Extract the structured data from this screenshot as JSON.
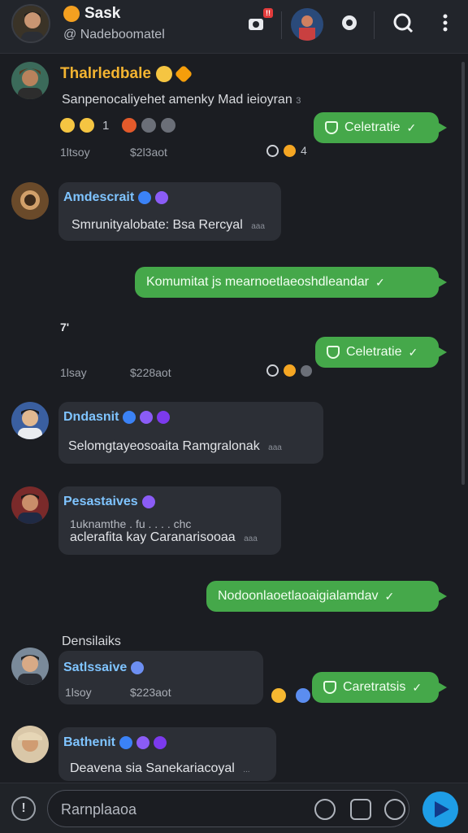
{
  "header": {
    "title": "Sask",
    "subtitle": "@ Nadeboomatel",
    "badge": "!!"
  },
  "messages": [
    {
      "name": "Thalrledbale",
      "text": "Sanpenocaliyehet amenky Mad ieioyran",
      "text_tail": "3",
      "react_count": "1",
      "meta_left": "1ltsoy",
      "meta_mid": "$2l3aot",
      "meta_right_num": "4"
    },
    {
      "name": "Amdescrait",
      "text": "Smrunityalobate: Bsa Rercyal",
      "ts": "aaa"
    },
    {
      "name": "Dndasnit",
      "text": "Selomgtayeosoaita Ramgralonak",
      "ts": "aaa"
    },
    {
      "name": "Pesastaives",
      "text_above": "1uknamthe . fu . . . . chc",
      "text": "aclerafita kay Caranarisooaa",
      "ts": "aaa"
    },
    {
      "name": "Satlssaive",
      "meta_left": "1lsoy",
      "meta_mid": "$223aot"
    },
    {
      "name": "Bathenit",
      "text": "Deavena sia Sanekariacoyal",
      "ts": "..."
    }
  ],
  "outgoing": {
    "celebrate_1": "Celetratie",
    "long_1": "Komumitat js mearnoetlaeoshdleandar",
    "celebrate_2": "Celetratie",
    "long_2": "Nodoonlaoetlaoaigialamdav",
    "celebrate_3": "Caretratsis"
  },
  "misc": {
    "stray_mark": "7'",
    "meta2_left": "1lsay",
    "meta2_mid": "$228aot",
    "section_label": "Densilaiks"
  },
  "composer": {
    "placeholder": "Rarnplaaoa",
    "left_icon": "!"
  },
  "colors": {
    "bg": "#1b1d22",
    "bubble": "#2c2f36",
    "green": "#45a84a",
    "name_blue": "#7fc4ff",
    "gold": "#f4b431",
    "send": "#1e9de6"
  },
  "icons": [
    "camera-icon",
    "settings-icon",
    "search-icon",
    "more-icon",
    "verified-icon",
    "shield-icon",
    "chevron-icon",
    "info-icon",
    "sticker-icon",
    "attach-icon",
    "send-icon"
  ]
}
